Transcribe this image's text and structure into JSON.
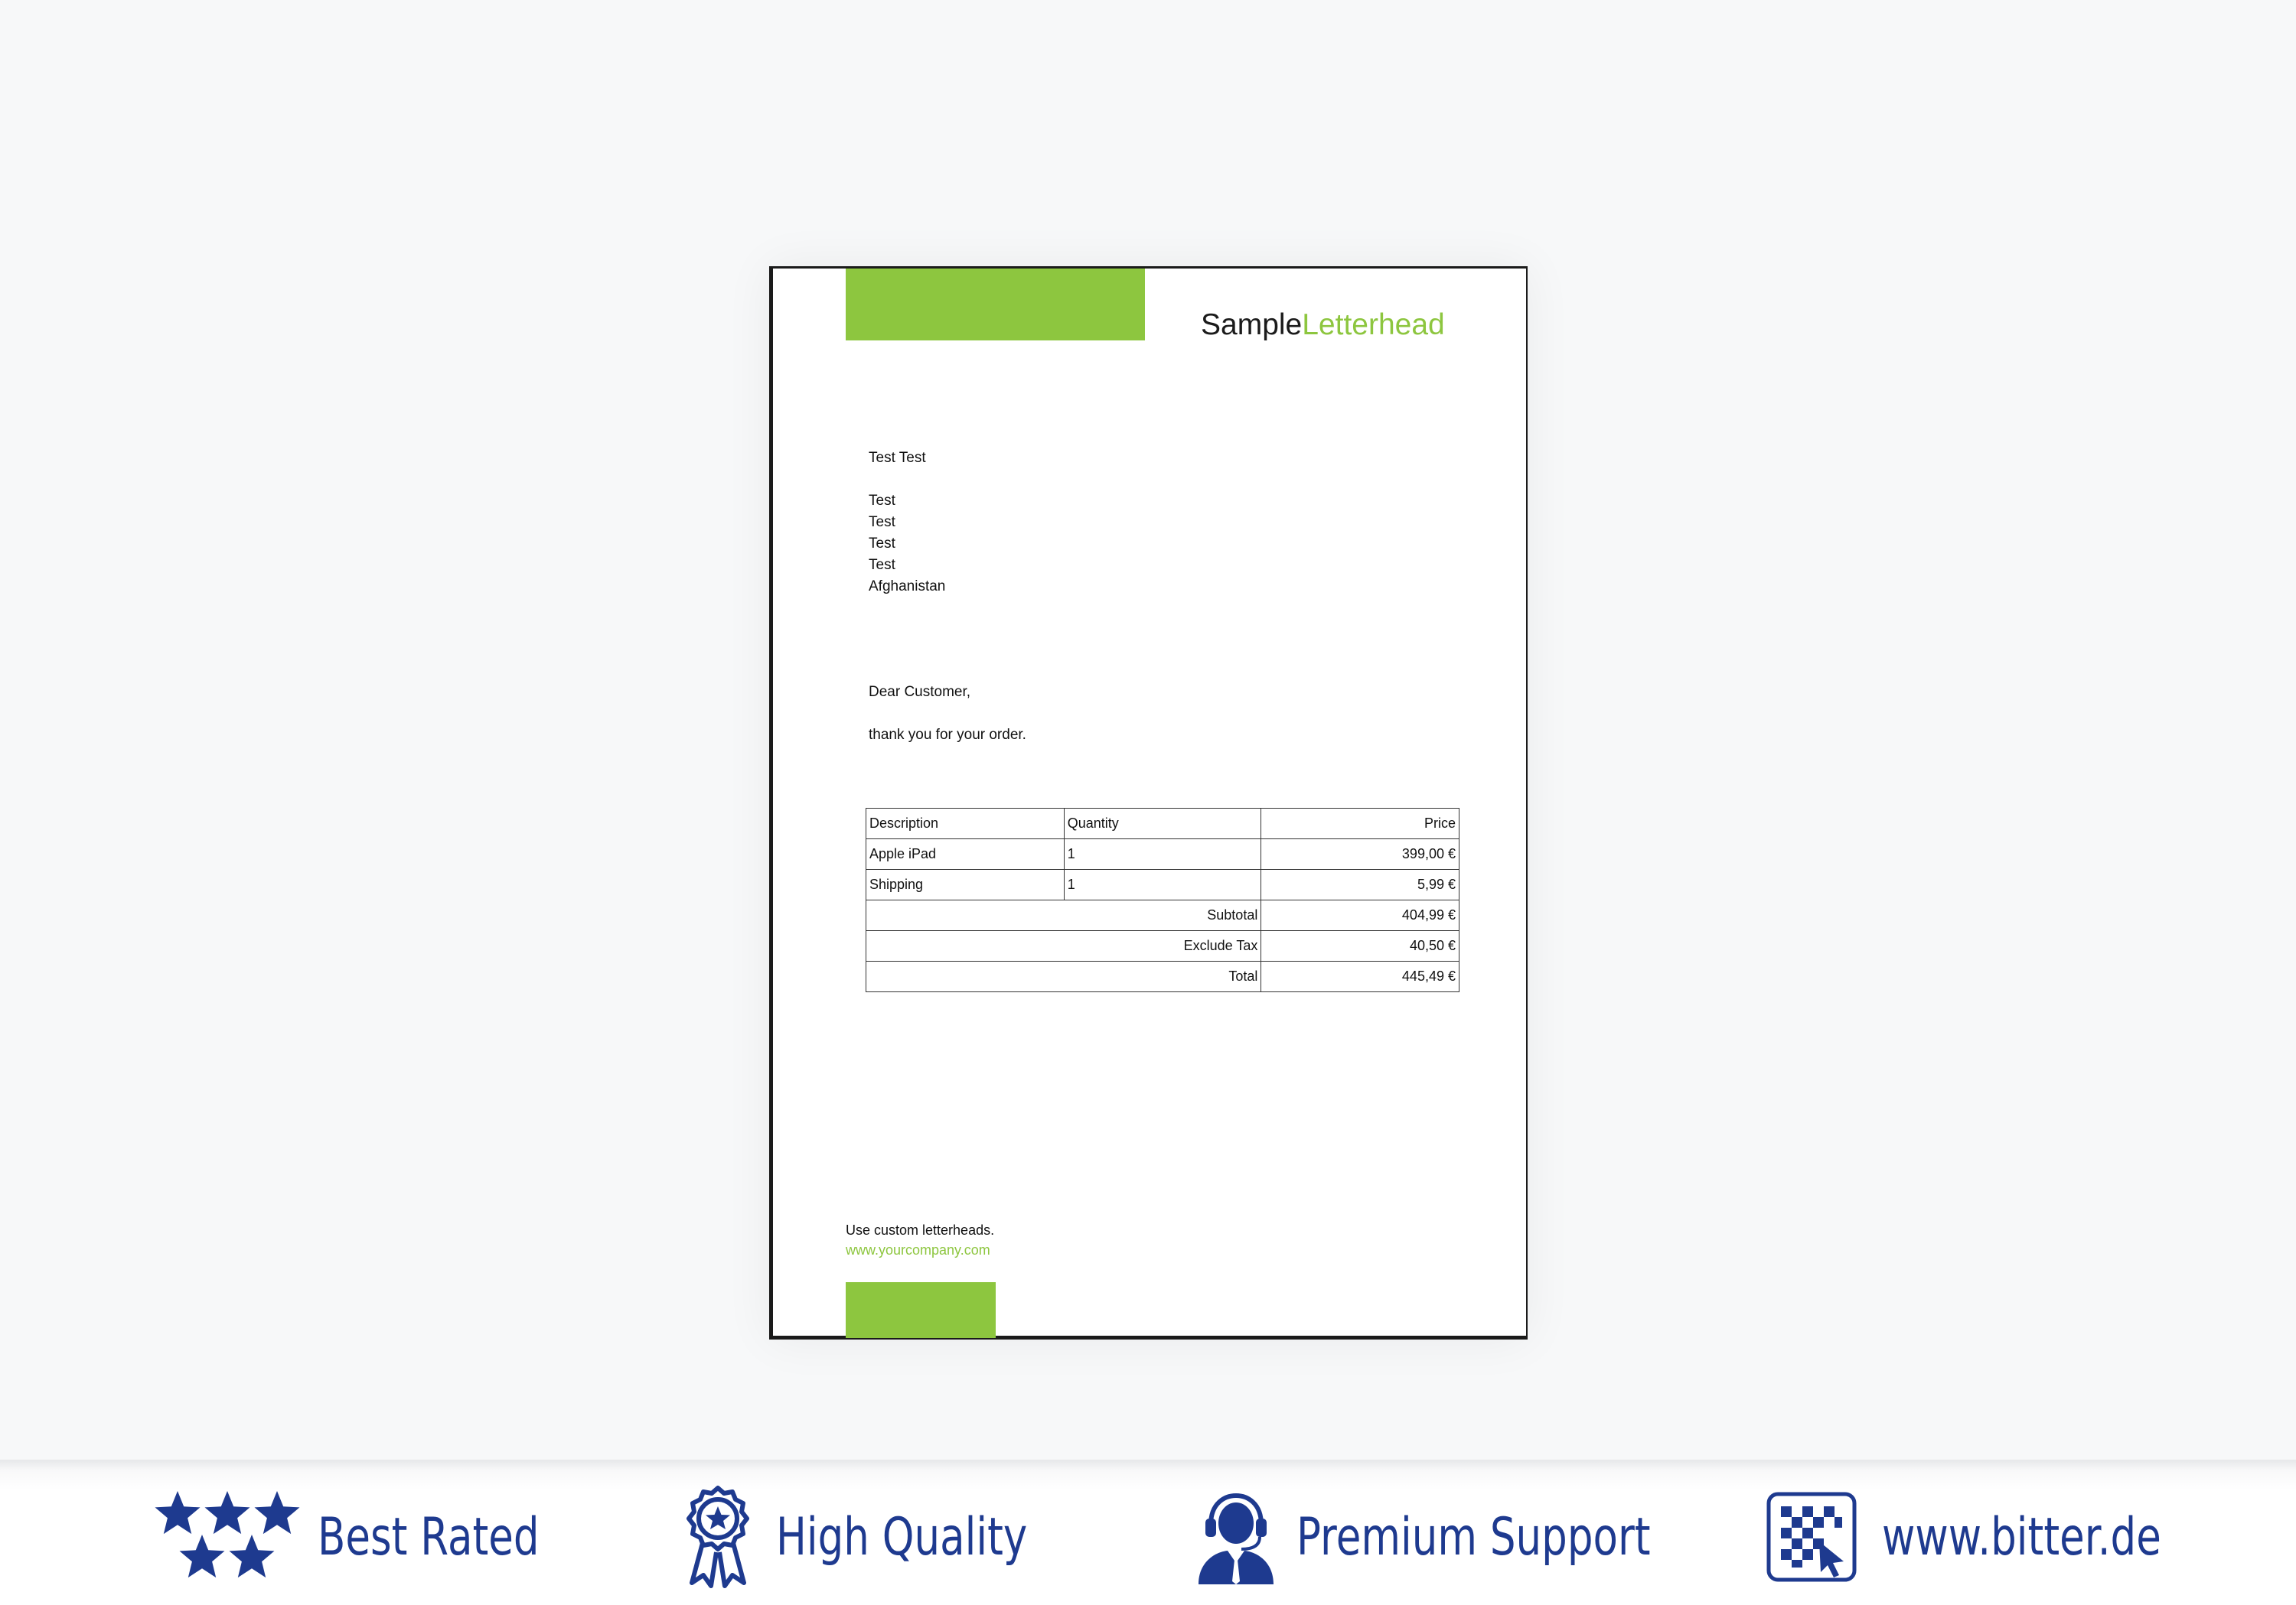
{
  "colors": {
    "accent_green": "#8dc63f",
    "badge_blue": "#1e3a8f",
    "background": "#f7f8f9"
  },
  "letter": {
    "logo": {
      "part1": "Sample",
      "part2": "Letterhead"
    },
    "recipient": {
      "name": "Test Test",
      "address_lines": [
        "Test",
        "Test",
        "Test",
        "Test",
        "Afghanistan"
      ]
    },
    "greeting": "Dear Customer,",
    "body": "thank you for your order.",
    "table": {
      "headers": {
        "description": "Description",
        "quantity": "Quantity",
        "price": "Price"
      },
      "items": [
        {
          "description": "Apple iPad",
          "quantity": "1",
          "price": "399,00 €"
        },
        {
          "description": "Shipping",
          "quantity": "1",
          "price": "5,99 €"
        }
      ],
      "summary": [
        {
          "label": "Subtotal",
          "value": "404,99 €"
        },
        {
          "label": "Exclude Tax",
          "value": "40,50 €"
        },
        {
          "label": "Total",
          "value": "445,49 €"
        }
      ]
    },
    "footer": {
      "tagline": "Use custom letterheads.",
      "url": "www.yourcompany.com"
    }
  },
  "badges": [
    {
      "icon": "stars-icon",
      "label": "Best Rated"
    },
    {
      "icon": "award-ribbon-icon",
      "label": "High Quality"
    },
    {
      "icon": "support-agent-icon",
      "label": "Premium Support"
    },
    {
      "icon": "qr-cursor-icon",
      "label": "www.bitter.de"
    }
  ]
}
